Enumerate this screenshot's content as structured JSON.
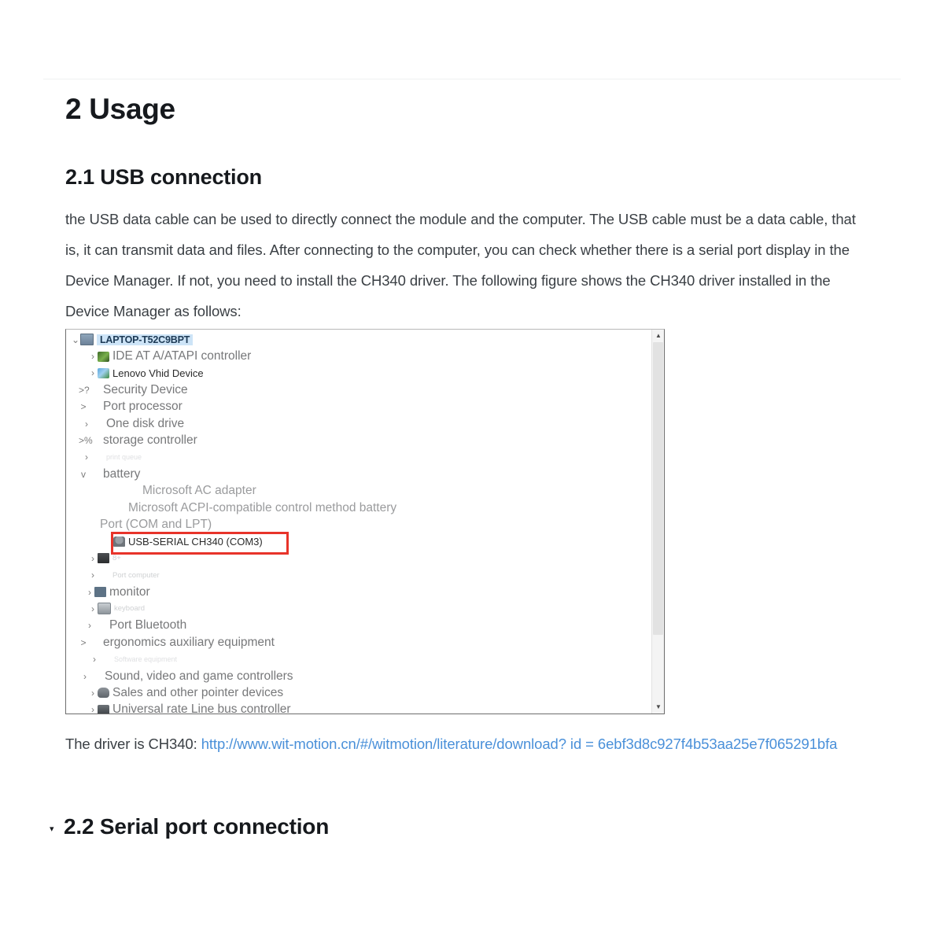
{
  "document": {
    "h1": "2 Usage",
    "section_2_1": {
      "heading": "2.1 USB connection",
      "paragraph": "the USB data cable can be used to directly connect the module and the computer. The USB cable must be a data cable, that is, it can transmit data and files. After connecting to the computer, you can check whether there is a serial port display in the Device Manager. If not, you need to install the CH340 driver. The following figure shows the CH340 driver installed in the Device Manager as follows:"
    },
    "driver_line": {
      "prefix": "The driver is CH340: ",
      "url_text": "http://www.wit-motion.cn/#/witmotion/literature/download? id = 6ebf3d8c927f4b53aa25e7f065291bfa"
    },
    "section_2_2": {
      "caret": "▾",
      "heading": "2.2 Serial port connection"
    }
  },
  "device_manager": {
    "scrollbar": {
      "up_arrow": "▲",
      "down_arrow": "▼"
    },
    "highlight_color": "#cde4f7",
    "callout_color": "#e8342a",
    "rows": [
      {
        "indent": 0,
        "chevron": "⌄",
        "icon": "computer-icon",
        "label": "LAPTOP-T52C9BPT",
        "style": "selected"
      },
      {
        "indent": 22,
        "chevron": "›",
        "icon": "ide-controller-icon",
        "label": "IDE AT A/ATAPI controller",
        "style": "t-mid"
      },
      {
        "indent": 22,
        "chevron": "›",
        "icon": "lenovo-vhid-icon",
        "label": "Lenovo Vhid Device",
        "style": "t-sharp"
      },
      {
        "indent": 10,
        "chevron": ">?",
        "icon": "blank-icon",
        "label": "Security Device",
        "style": "t-mid"
      },
      {
        "indent": 10,
        "chevron": ">",
        "icon": "blank-icon",
        "label": "Port processor",
        "style": "t-mid"
      },
      {
        "indent": 14,
        "chevron": "›",
        "icon": "blank-icon",
        "label": "One disk drive",
        "style": "t-mid"
      },
      {
        "indent": 10,
        "chevron": ">%",
        "icon": "blank-icon",
        "label": "storage controller",
        "style": "t-mid"
      },
      {
        "indent": 14,
        "chevron": "›",
        "icon": "blank-icon",
        "label": "print queue",
        "style": "t-vfaint"
      },
      {
        "indent": 10,
        "chevron": "v",
        "icon": "blank-icon",
        "label": "battery",
        "style": "t-mid"
      },
      {
        "indent": 60,
        "chevron": "",
        "icon": "blank-icon",
        "label": "Microsoft AC adapter",
        "style": "t-soft"
      },
      {
        "indent": 42,
        "chevron": "",
        "icon": "blank-icon",
        "label": "Microsoft ACPI-compatible control method battery",
        "style": "t-soft"
      },
      {
        "indent": 6,
        "chevron": "",
        "icon": "blank-icon",
        "label": "Port (COM and LPT)",
        "style": "t-soft"
      },
      {
        "indent": 42,
        "chevron": "",
        "icon": "usb-serial-icon",
        "label": "USB-SERIAL CH340 (COM3)",
        "style": "t-sharp"
      },
      {
        "indent": 22,
        "chevron": "›",
        "icon": "device-icon",
        "label": "8+",
        "style": "t-faint"
      },
      {
        "indent": 22,
        "chevron": "›",
        "icon": "blank-icon",
        "label": "Port computer",
        "style": "t-faint"
      },
      {
        "indent": 18,
        "chevron": "›",
        "icon": "monitor-icon",
        "label": "monitor",
        "style": "t-mid"
      },
      {
        "indent": 22,
        "chevron": "›",
        "icon": "keyboard-icon",
        "label": "keyboard",
        "style": "t-faint"
      },
      {
        "indent": 18,
        "chevron": "›",
        "icon": "blank-icon",
        "label": "Port Bluetooth",
        "style": "t-mid"
      },
      {
        "indent": 10,
        "chevron": ">",
        "icon": "blank-icon",
        "label": "ergonomics auxiliary equipment",
        "style": "t-mid"
      },
      {
        "indent": 24,
        "chevron": "›",
        "icon": "blank-icon",
        "label": "Software equipment",
        "style": "t-vfaint"
      },
      {
        "indent": 12,
        "chevron": "›",
        "icon": "blank-icon",
        "label": "Sound, video and game controllers",
        "style": "t-mid"
      },
      {
        "indent": 22,
        "chevron": "›",
        "icon": "mouse-icon",
        "label": "Sales and other pointer devices",
        "style": "t-mid"
      },
      {
        "indent": 22,
        "chevron": "›",
        "icon": "usb-plug-icon",
        "label": "Universal rate Line bus controller",
        "style": "t-mid"
      }
    ]
  }
}
